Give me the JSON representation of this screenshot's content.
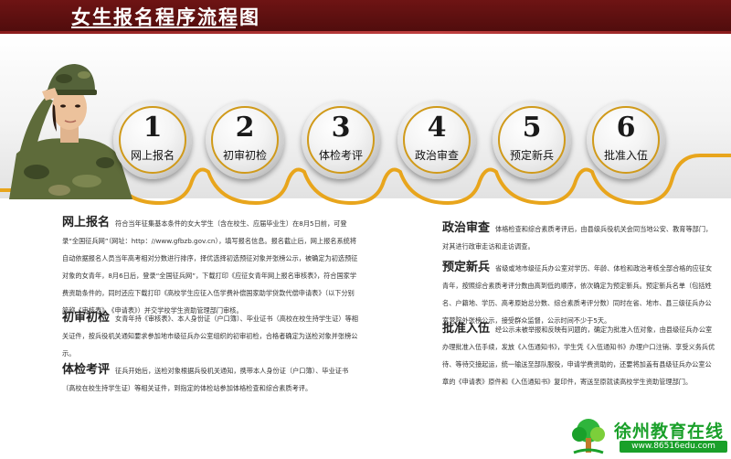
{
  "header": {
    "title": "女生报名程序流程图"
  },
  "steps": [
    {
      "number": "1",
      "label": "网上报名"
    },
    {
      "number": "2",
      "label": "初审初检"
    },
    {
      "number": "3",
      "label": "体检考评"
    },
    {
      "number": "4",
      "label": "政治审查"
    },
    {
      "number": "5",
      "label": "预定新兵"
    },
    {
      "number": "6",
      "label": "批准入伍"
    }
  ],
  "sections": {
    "online": {
      "title": "网上报名",
      "body": "符合当年征集基本条件的女大学生（含在校生、应届毕业生）在8月5日前，可登录“全国征兵网”（网址：http：//www.gfbzb.gov.cn），填写报名信息。报名截止后，网上报名系统将自动依据报名人员当年高考相对分数进行排序，择优选择初选预征对象并张榜公示，被确定为初选预征对象的女青年，8月6日后，登录“全国征兵网”，下载打印《应征女青年网上报名审核表》，符合国家学费资助条件的，同时还应下载打印《高校学生应征入伍学费补偿国家助学贷款代偿申请表》（以下分别简称《审核表》、《申请表》）并交学校学生资助管理部门审核。"
    },
    "initial": {
      "title": "初审初检",
      "body": "女青年持《审核表》、本人身份证（户口簿）、毕业证书（高校在校生持学生证）等相关证件，按兵役机关通知要求参加地市级征兵办公室组织的初审初检，合格者确定为送检对象并张榜公示。"
    },
    "physical": {
      "title": "体检考评",
      "body": "征兵开始后，送检对象根据兵役机关通知，携带本人身份证（户口簿）、毕业证书（高校在校生持学生证）等相关证件，到指定的体检站参加体格检查和综合素质考评。"
    },
    "political": {
      "title": "政治审查",
      "body": "体格检查和综合素质考评后，由县级兵役机关会同当地公安、教育等部门，对其进行政审走访和走访调查。"
    },
    "reserve": {
      "title": "预定新兵",
      "body": "省级或地市级征兵办公室对学历、年龄、体检和政治考核全部合格的应征女青年，按照综合素质考评分数由高到低的顺序，依次确定为预定新兵。预定新兵名单（包括姓名、户籍地、学历、高考原始总分数、综合素质考评分数）同时在省、地市、县三级征兵办公室营院外张榜公示，接受群众监督，公示时间不少于5天。"
    },
    "approve": {
      "title": "批准入伍",
      "body": "经公示未被举报和反映有问题的，确定为批准入伍对象，由县级征兵办公室办理批准入伍手续，发放《入伍通知书》，学生凭《入伍通知书》办理户口注销、享受义务兵优待、等待交接起运，统一输送至部队服役，申请学费资助的，还要将加盖有县级征兵办公室公章的《申请表》原件和《入伍通知书》复印件，寄送至原就读高校学生资助管理部门。"
    }
  },
  "footer": {
    "logo_text": "徐州教育在线",
    "url": "www.86516edu.com"
  },
  "colors": {
    "banner": "#5a0f0f",
    "gold": "#e8a51c",
    "green": "#1aa02a"
  },
  "icons": {
    "soldier": "saluting-soldier",
    "logo": "tree-logo-icon"
  }
}
